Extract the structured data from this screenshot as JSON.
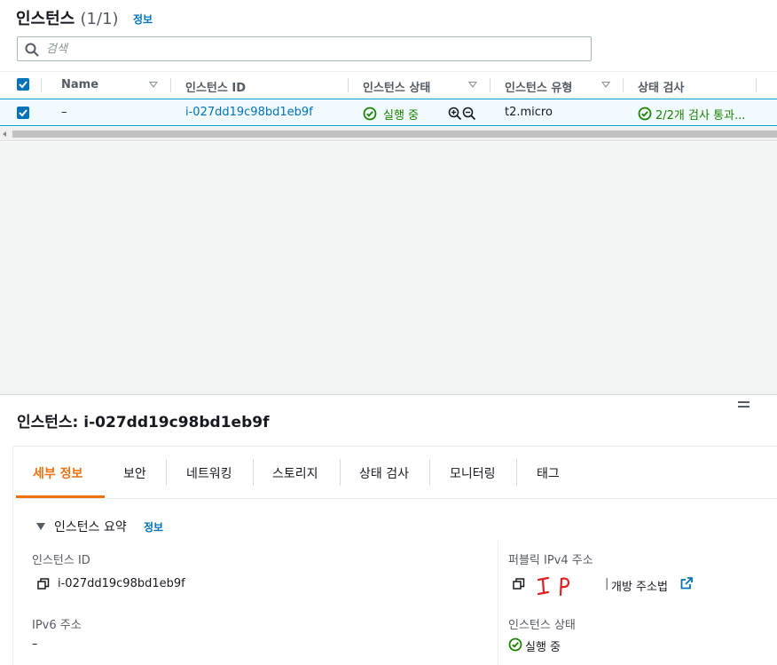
{
  "header": {
    "title": "인스턴스",
    "count": "(1/1)",
    "info_link": "정보"
  },
  "search": {
    "placeholder": "검색",
    "value": ""
  },
  "table": {
    "columns": [
      "Name",
      "인스턴스 ID",
      "인스턴스 상태",
      "인스턴스 유형",
      "상태 검사"
    ],
    "rows": [
      {
        "name": "–",
        "instance_id": "i-027dd19c98bd1eb9f",
        "state": "실행 중",
        "type": "t2.micro",
        "status_check": "2/2개 검사 통과..."
      }
    ]
  },
  "details": {
    "title": "인스턴스: i-027dd19c98bd1eb9f",
    "tabs": [
      "세부 정보",
      "보안",
      "네트워킹",
      "스토리지",
      "상태 검사",
      "모니터링",
      "태그"
    ],
    "active_tab": "세부 정보",
    "summary": {
      "title": "인스턴스 요약",
      "info_link": "정보",
      "instance_id_label": "인스턴스 ID",
      "instance_id": "i-027dd19c98bd1eb9f",
      "ipv6_label": "IPv6 주소",
      "ipv6_value": "–",
      "public_ipv4_label": "퍼블릭 IPv4 주소",
      "public_ipv4_value": "IP",
      "open_address_link": "개방 주소법",
      "state_label": "인스턴스 상태",
      "state_value": "실행 중"
    }
  },
  "colors": {
    "link": "#0073bb",
    "success": "#1d8102",
    "active_tab": "#ec7211",
    "selected_row_bg": "#f1faff"
  }
}
